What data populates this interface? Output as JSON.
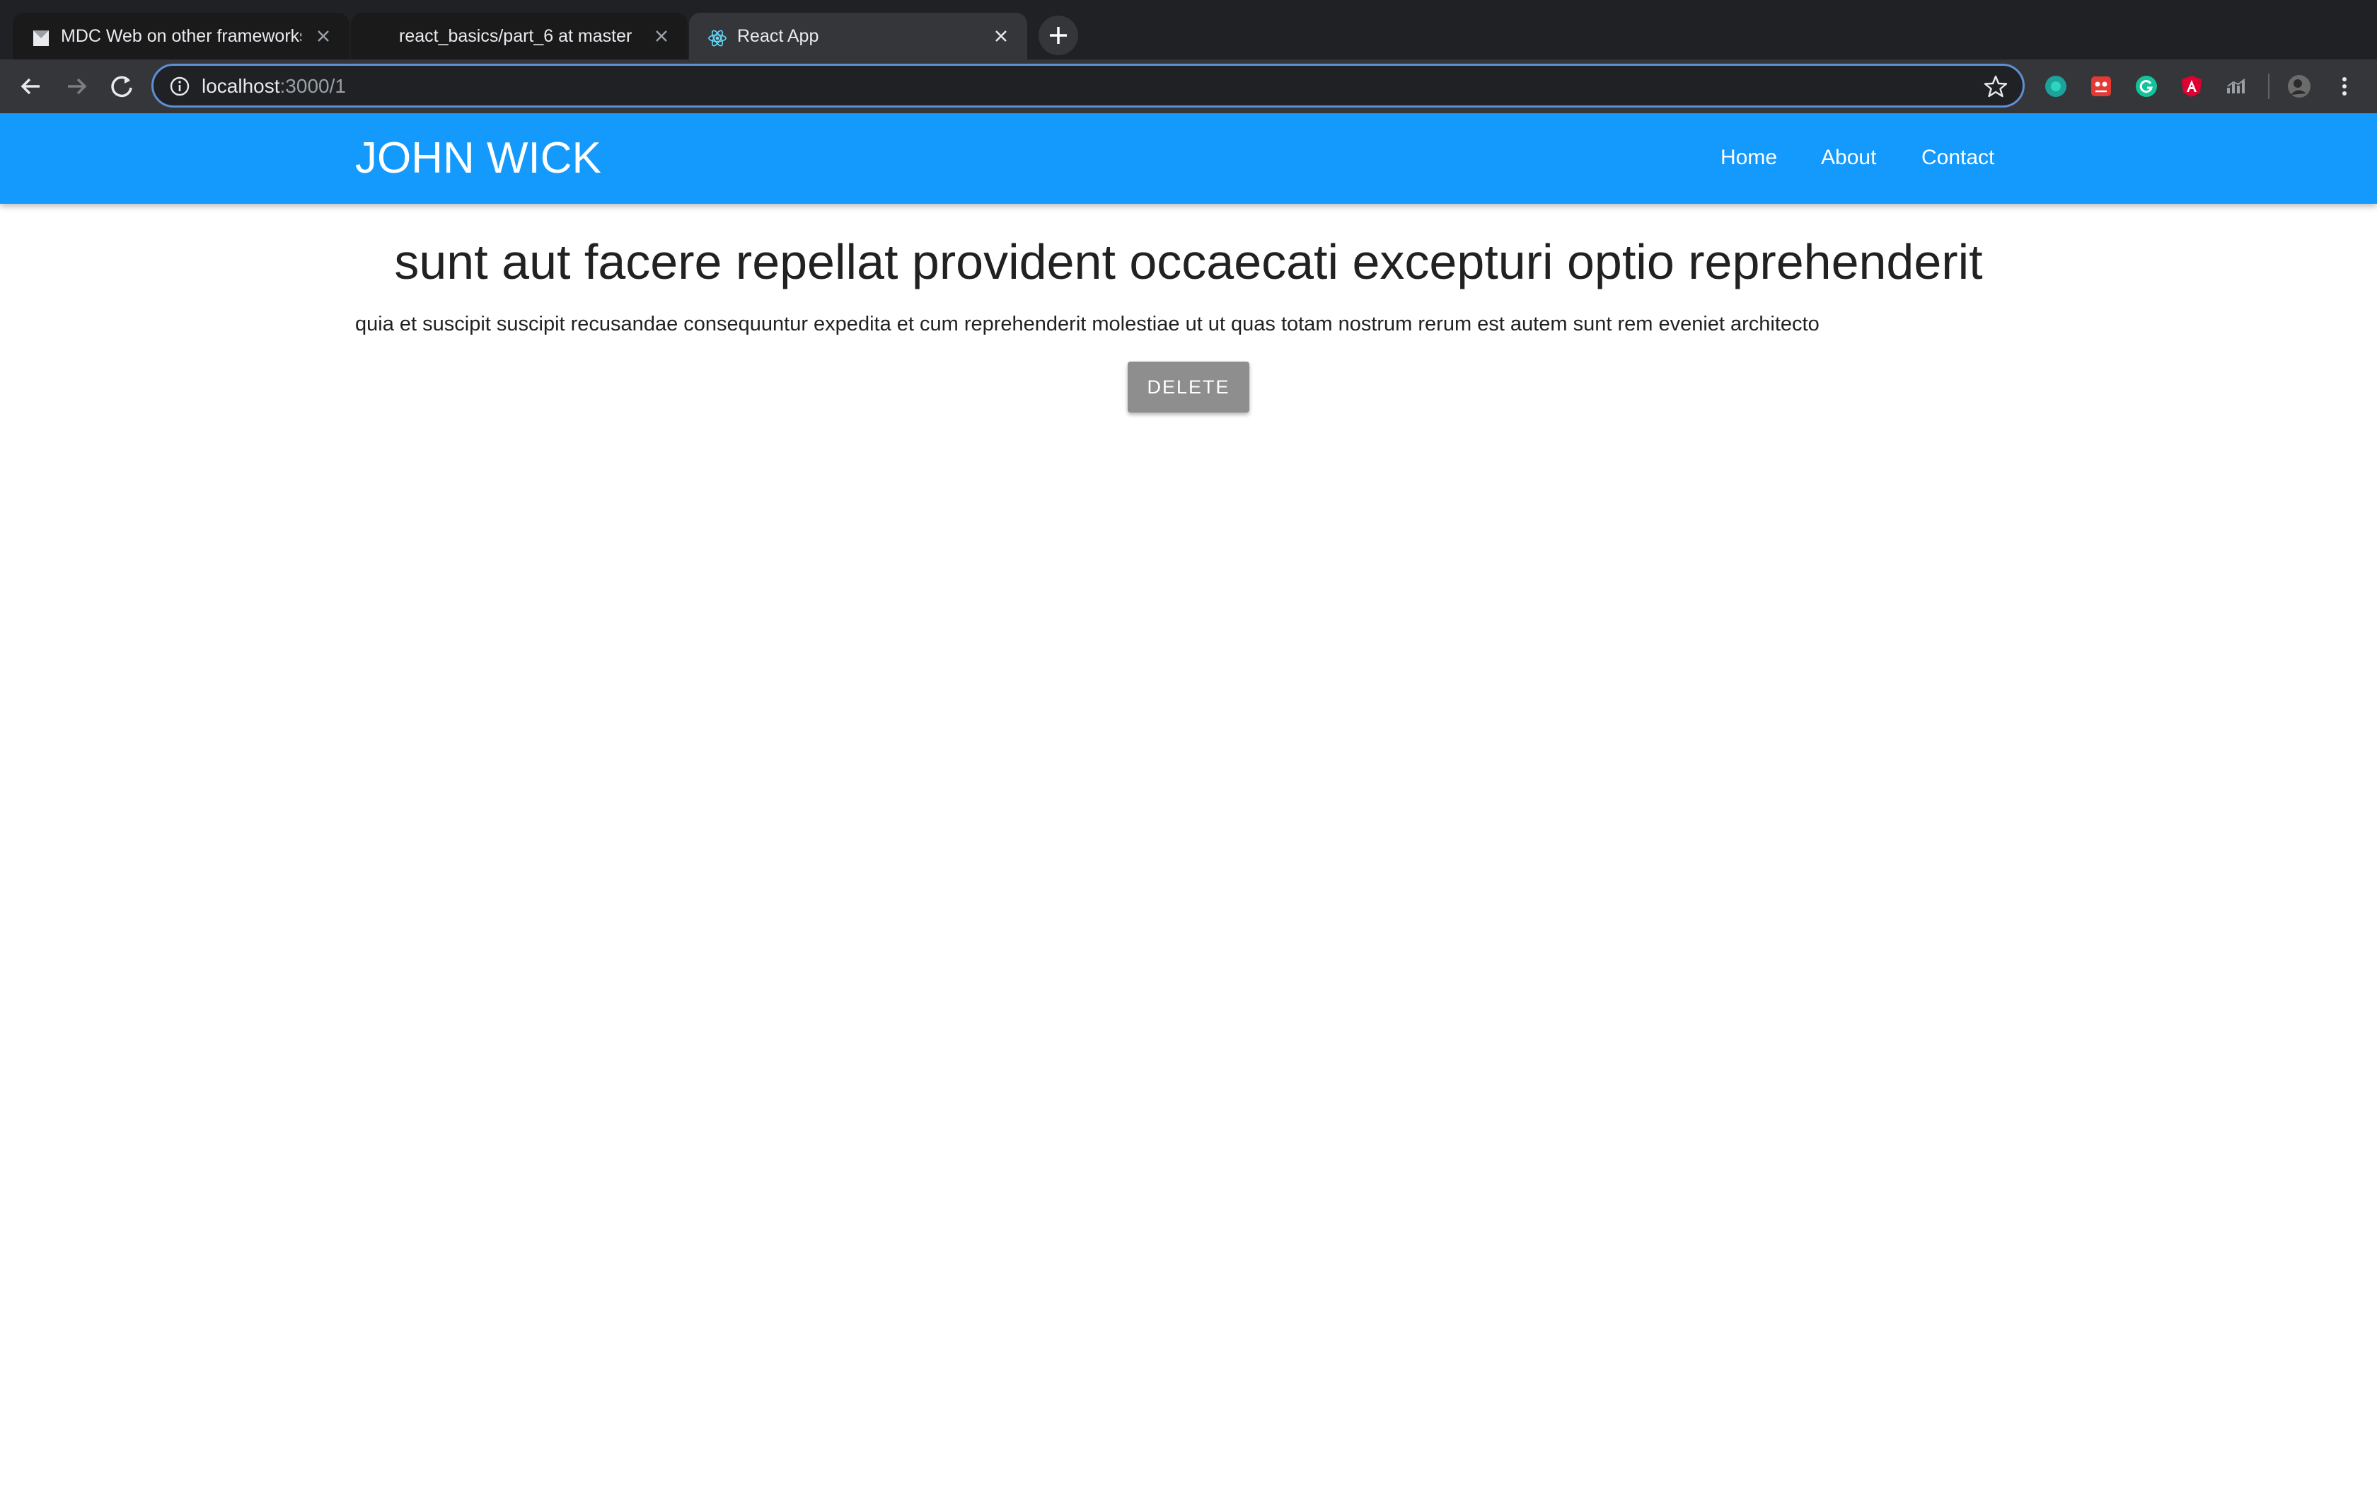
{
  "browser": {
    "tabs": [
      {
        "title": "MDC Web on other frameworks",
        "icon": "mdc-favicon-icon",
        "active": false
      },
      {
        "title": "react_basics/part_6 at master",
        "icon": "github-favicon-icon",
        "active": false
      },
      {
        "title": "React App",
        "icon": "react-favicon-icon",
        "active": true
      }
    ],
    "address": {
      "host": "localhost",
      "path": ":3000/1"
    },
    "extensions": [
      "teal-circle-extension-icon",
      "red-ghost-extension-icon",
      "grammarly-icon",
      "angular-icon",
      "bar-chart-extension-icon",
      "profile-avatar-icon"
    ],
    "colors": {
      "chrome_dark": "#202124",
      "toolbar": "#35363a",
      "focus_ring": "#5f8fd4"
    }
  },
  "app": {
    "brand": "JOHN WICK",
    "nav": {
      "home": "Home",
      "about": "About",
      "contact": "Contact"
    },
    "colors": {
      "appbar": "#1499fd",
      "button": "#8e8e8e",
      "text": "#212121"
    }
  },
  "post": {
    "title": "sunt aut facere repellat provident occaecati excepturi optio reprehenderit",
    "body": "quia et suscipit suscipit recusandae consequuntur expedita et cum reprehenderit molestiae ut ut quas totam nostrum rerum est autem sunt rem eveniet architecto",
    "delete_label": "DELETE"
  }
}
